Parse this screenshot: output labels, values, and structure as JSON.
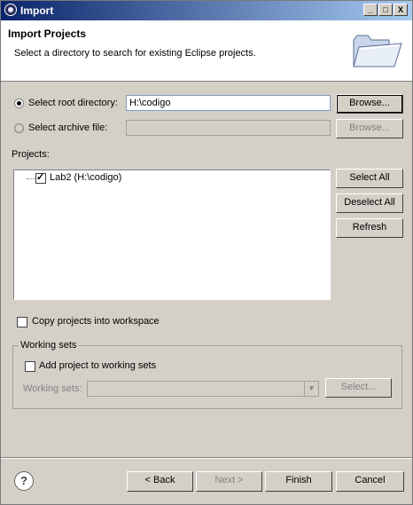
{
  "window": {
    "title": "Import",
    "controls": {
      "minimize": "_",
      "maximize": "□",
      "close": "X"
    }
  },
  "header": {
    "title": "Import Projects",
    "description": "Select a directory to search for existing Eclipse projects."
  },
  "source": {
    "root_label": "Select root directory:",
    "root_value": "H:\\codigo",
    "archive_label": "Select archive file:",
    "archive_value": "",
    "browse_label": "Browse...",
    "selected": "root"
  },
  "projects": {
    "label": "Projects:",
    "items": [
      {
        "label": "Lab2 (H:\\codigo)",
        "checked": true
      }
    ],
    "select_all": "Select All",
    "deselect_all": "Deselect All",
    "refresh": "Refresh"
  },
  "copy_projects": {
    "label": "Copy projects into workspace",
    "checked": false
  },
  "working_sets": {
    "legend": "Working sets",
    "add_label": "Add project to working sets",
    "add_checked": false,
    "combo_label": "Working sets:",
    "combo_value": "",
    "select_label": "Select..."
  },
  "footer": {
    "help_icon": "?",
    "back": "< Back",
    "next": "Next >",
    "finish": "Finish",
    "cancel": "Cancel"
  },
  "icons": {
    "app": "eclipse-icon",
    "banner": "open-folder-icon",
    "help": "help-icon",
    "dropdown": "chevron-down-icon"
  },
  "colors": {
    "title_bar_start": "#0a246a",
    "title_bar_end": "#a6caf0",
    "dialog_bg": "#d4d0c8",
    "disabled_text": "#808080"
  }
}
